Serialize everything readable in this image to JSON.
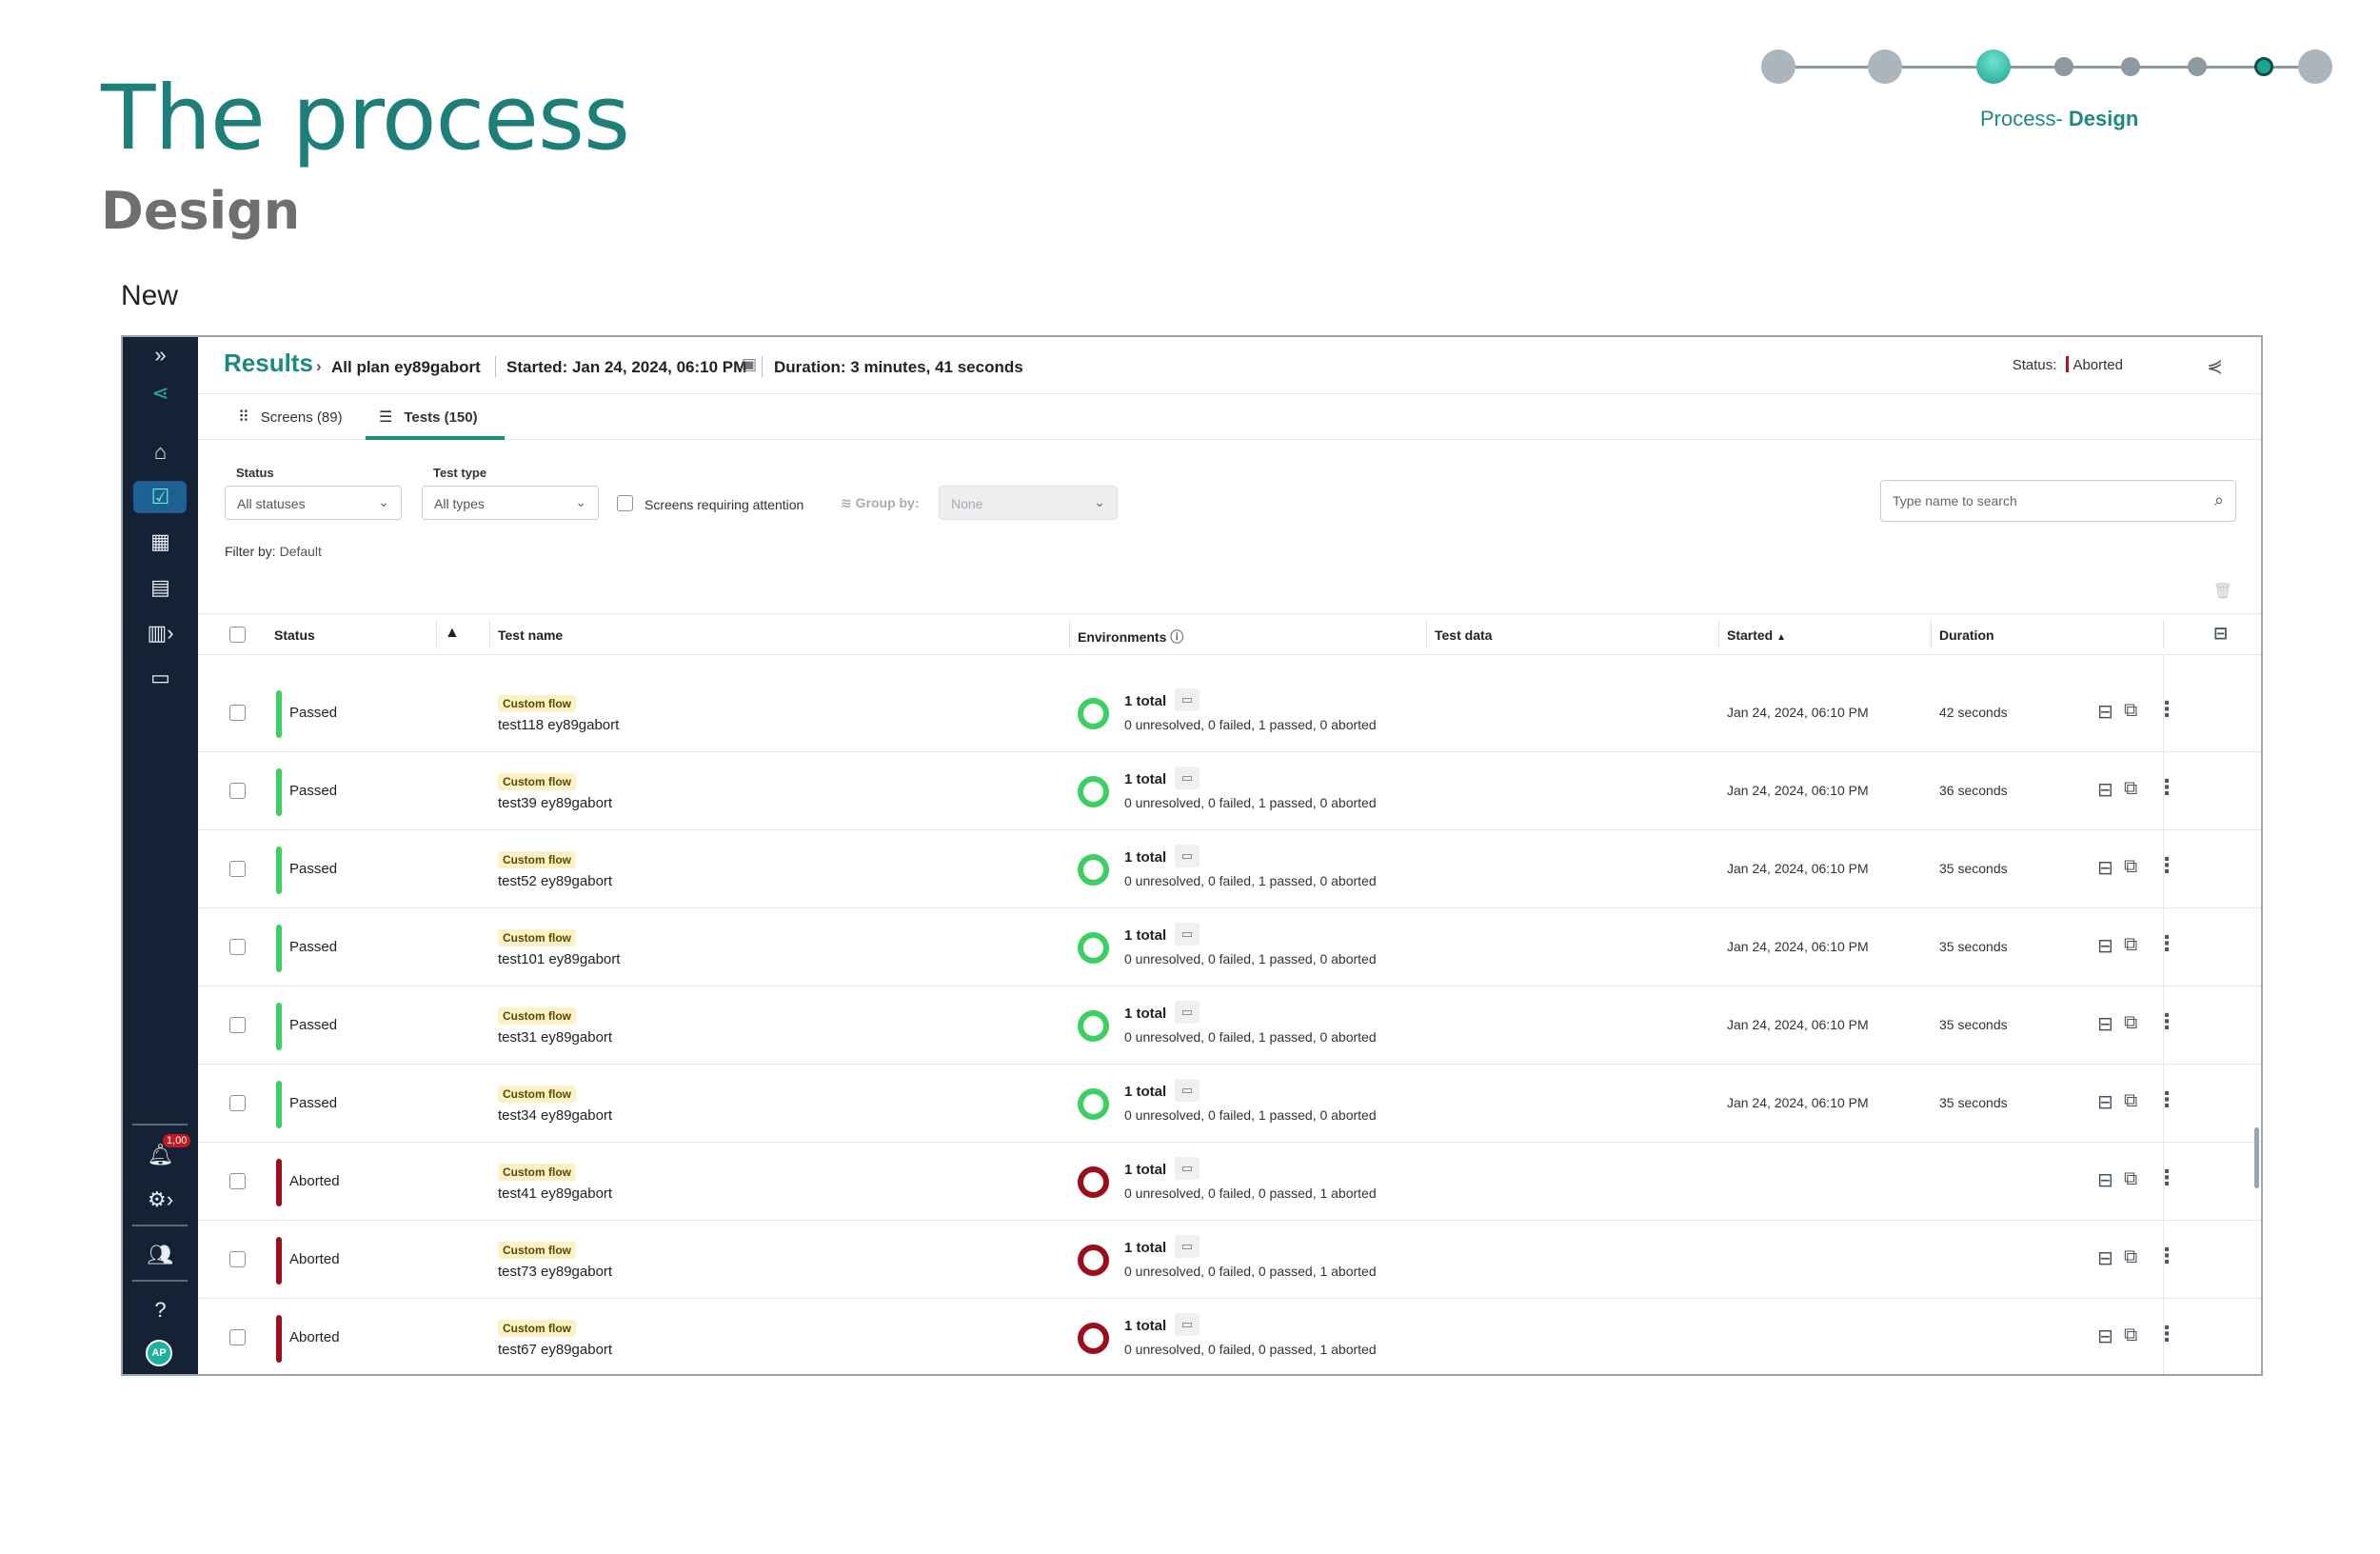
{
  "slide": {
    "title": "The process",
    "subtitle": "Design",
    "label_new": "New",
    "stepper_label_prefix": "Process- ",
    "stepper_label_bold": "Design"
  },
  "sidebar": {
    "icons": [
      "expand-icon",
      "logo-icon",
      "home-icon",
      "results-icon",
      "dashboard-icon",
      "calendar-icon",
      "reports-icon",
      "monitor-icon",
      "bell-icon",
      "settings-icon",
      "team-icon",
      "help-icon"
    ],
    "notification_badge": "1,00",
    "avatar_initials": "AP"
  },
  "header": {
    "results": "Results",
    "plan": "All plan ey89gabort",
    "started": "Started: Jan 24, 2024, 06:10 PM",
    "duration": "Duration: 3 minutes, 41 seconds",
    "status_label": "Status:",
    "status_value": "Aborted"
  },
  "tabs": [
    {
      "label": "Screens (89)"
    },
    {
      "label": "Tests (150)"
    }
  ],
  "filters": {
    "status_label": "Status",
    "status_value": "All statuses",
    "type_label": "Test type",
    "type_value": "All types",
    "attention_label": "Screens requiring attention",
    "group_label": "Group by:",
    "group_value": "None",
    "search_placeholder": "Type name to search",
    "filter_by_label": "Filter by:",
    "filter_by_value": "Default"
  },
  "columns": {
    "status": "Status",
    "test_name": "Test name",
    "environments": "Environments",
    "test_data": "Test data",
    "started": "Started",
    "duration": "Duration"
  },
  "colors": {
    "accent": "#1d8a80",
    "passed": "#3ccf61",
    "aborted": "#9b0f1d"
  },
  "rows": [
    {
      "status": "Passed",
      "tag": "Custom flow",
      "name": "test118 ey89gabort",
      "env_total": "1 total",
      "env_summary": "0 unresolved, 0 failed, 1 passed, 0 aborted",
      "started": "Jan 24, 2024, 06:10 PM",
      "duration": "42 seconds"
    },
    {
      "status": "Passed",
      "tag": "Custom flow",
      "name": "test39 ey89gabort",
      "env_total": "1 total",
      "env_summary": "0 unresolved, 0 failed, 1 passed, 0 aborted",
      "started": "Jan 24, 2024, 06:10 PM",
      "duration": "36 seconds"
    },
    {
      "status": "Passed",
      "tag": "Custom flow",
      "name": "test52 ey89gabort",
      "env_total": "1 total",
      "env_summary": "0 unresolved, 0 failed, 1 passed, 0 aborted",
      "started": "Jan 24, 2024, 06:10 PM",
      "duration": "35 seconds"
    },
    {
      "status": "Passed",
      "tag": "Custom flow",
      "name": "test101 ey89gabort",
      "env_total": "1 total",
      "env_summary": "0 unresolved, 0 failed, 1 passed, 0 aborted",
      "started": "Jan 24, 2024, 06:10 PM",
      "duration": "35 seconds"
    },
    {
      "status": "Passed",
      "tag": "Custom flow",
      "name": "test31 ey89gabort",
      "env_total": "1 total",
      "env_summary": "0 unresolved, 0 failed, 1 passed, 0 aborted",
      "started": "Jan 24, 2024, 06:10 PM",
      "duration": "35 seconds"
    },
    {
      "status": "Passed",
      "tag": "Custom flow",
      "name": "test34 ey89gabort",
      "env_total": "1 total",
      "env_summary": "0 unresolved, 0 failed, 1 passed, 0 aborted",
      "started": "Jan 24, 2024, 06:10 PM",
      "duration": "35 seconds"
    },
    {
      "status": "Aborted",
      "tag": "Custom flow",
      "name": "test41 ey89gabort",
      "env_total": "1 total",
      "env_summary": "0 unresolved, 0 failed, 0 passed, 1 aborted",
      "started": "",
      "duration": ""
    },
    {
      "status": "Aborted",
      "tag": "Custom flow",
      "name": "test73 ey89gabort",
      "env_total": "1 total",
      "env_summary": "0 unresolved, 0 failed, 0 passed, 1 aborted",
      "started": "",
      "duration": ""
    },
    {
      "status": "Aborted",
      "tag": "Custom flow",
      "name": "test67 ey89gabort",
      "env_total": "1 total",
      "env_summary": "0 unresolved, 0 failed, 0 passed, 1 aborted",
      "started": "",
      "duration": ""
    }
  ]
}
